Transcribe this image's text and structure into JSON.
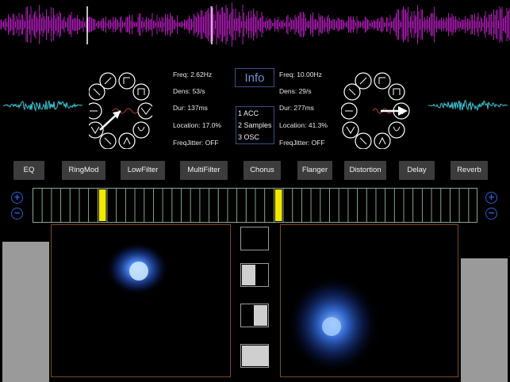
{
  "left_grain": {
    "freq": "Freq: 2.62Hz",
    "dens": "Dens: 53/s",
    "dur": "Dur: 137ms",
    "location": "Location: 17.0%",
    "freqjitter": "FreqJitter: OFF"
  },
  "right_grain": {
    "freq": "Freq: 10.00Hz",
    "dens": "Dens: 29/s",
    "dur": "Dur: 277ms",
    "location": "Location: 41.3%",
    "freqjitter": "FreqJitter: OFF"
  },
  "info_label": "Info",
  "presets": [
    "1 ACC",
    "2 Samples",
    "3 OSC"
  ],
  "effects": [
    "EQ",
    "RingMod",
    "LowFilter",
    "MultiFilter",
    "Chorus",
    "Flanger",
    "Distortion",
    "Delay",
    "Reverb"
  ],
  "sequencer": {
    "steps": 48,
    "active_steps": [
      7,
      26
    ]
  },
  "zoom_labels": {
    "plus": "+",
    "minus": "−"
  },
  "colors": {
    "waveform": "#b01ab8",
    "mini_wave": "#38c8d8",
    "step_active": "#f2e800",
    "accent_blue": "#2c5fd6",
    "cloud": "#4a8cff"
  },
  "levels": {
    "left_bar": 0.93,
    "right_bar": 0.82,
    "mix_boxes": [
      0.0,
      0.5,
      0.5,
      1.0
    ]
  }
}
